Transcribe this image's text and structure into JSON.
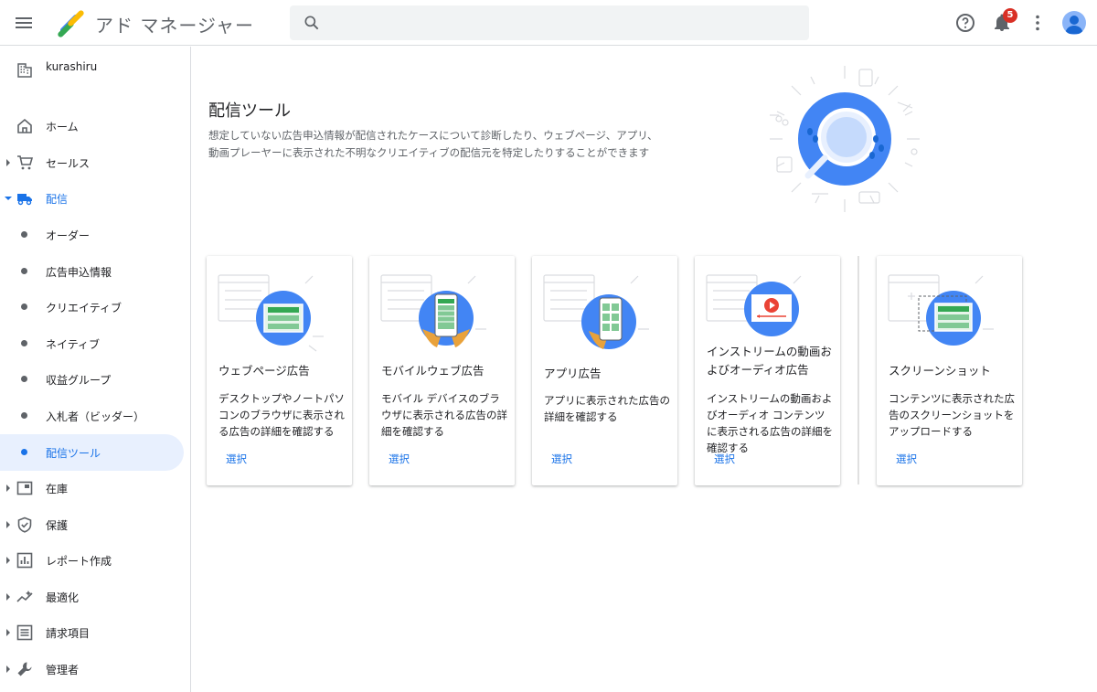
{
  "header": {
    "app_title": "アド マネージャー",
    "search_placeholder": "",
    "notification_count": "5"
  },
  "sidebar": {
    "network_name": "kurashiru",
    "items": [
      {
        "label": "ホーム",
        "icon": "home-icon"
      },
      {
        "label": "セールス",
        "icon": "cart-icon"
      },
      {
        "label": "配信",
        "icon": "truck-icon"
      },
      {
        "label": "オーダー"
      },
      {
        "label": "広告申込情報"
      },
      {
        "label": "クリエイティブ"
      },
      {
        "label": "ネイティブ"
      },
      {
        "label": "収益グループ"
      },
      {
        "label": "入札者（ビッダー）"
      },
      {
        "label": "配信ツール"
      },
      {
        "label": "在庫",
        "icon": "inventory-icon"
      },
      {
        "label": "保護",
        "icon": "shield-icon"
      },
      {
        "label": "レポート作成",
        "icon": "report-icon"
      },
      {
        "label": "最適化",
        "icon": "optimization-icon"
      },
      {
        "label": "請求項目",
        "icon": "billing-icon"
      },
      {
        "label": "管理者",
        "icon": "wrench-icon"
      }
    ]
  },
  "main": {
    "title": "配信ツール",
    "description": "想定していない広告申込情報が配信されたケースについて診断したり、ウェブページ、アプリ、動画プレーヤーに表示された不明なクリエイティブの配信元を特定したりすることができます",
    "select_label": "選択",
    "cards": [
      {
        "title": "ウェブページ広告",
        "description": "デスクトップやノートパソコンのブラウザに表示される広告の詳細を確認する"
      },
      {
        "title": "モバイルウェブ広告",
        "description": "モバイル デバイスのブラウザに表示される広告の詳細を確認する"
      },
      {
        "title": "アプリ広告",
        "description": "アプリに表示された広告の詳細を確認する"
      },
      {
        "title": "インストリームの動画およびオーディオ広告",
        "description": "インストリームの動画およびオーディオ コンテンツに表示される広告の詳細を確認する"
      },
      {
        "title": "スクリーンショット",
        "description": "コンテンツに表示された広告のスクリーンショットをアップロードする"
      }
    ]
  },
  "colors": {
    "accent": "#1a73e8",
    "active_bg": "#e8f0fe",
    "badge": "#d93025",
    "illustration_green": "#34a853",
    "illustration_blue": "#4285f4"
  }
}
